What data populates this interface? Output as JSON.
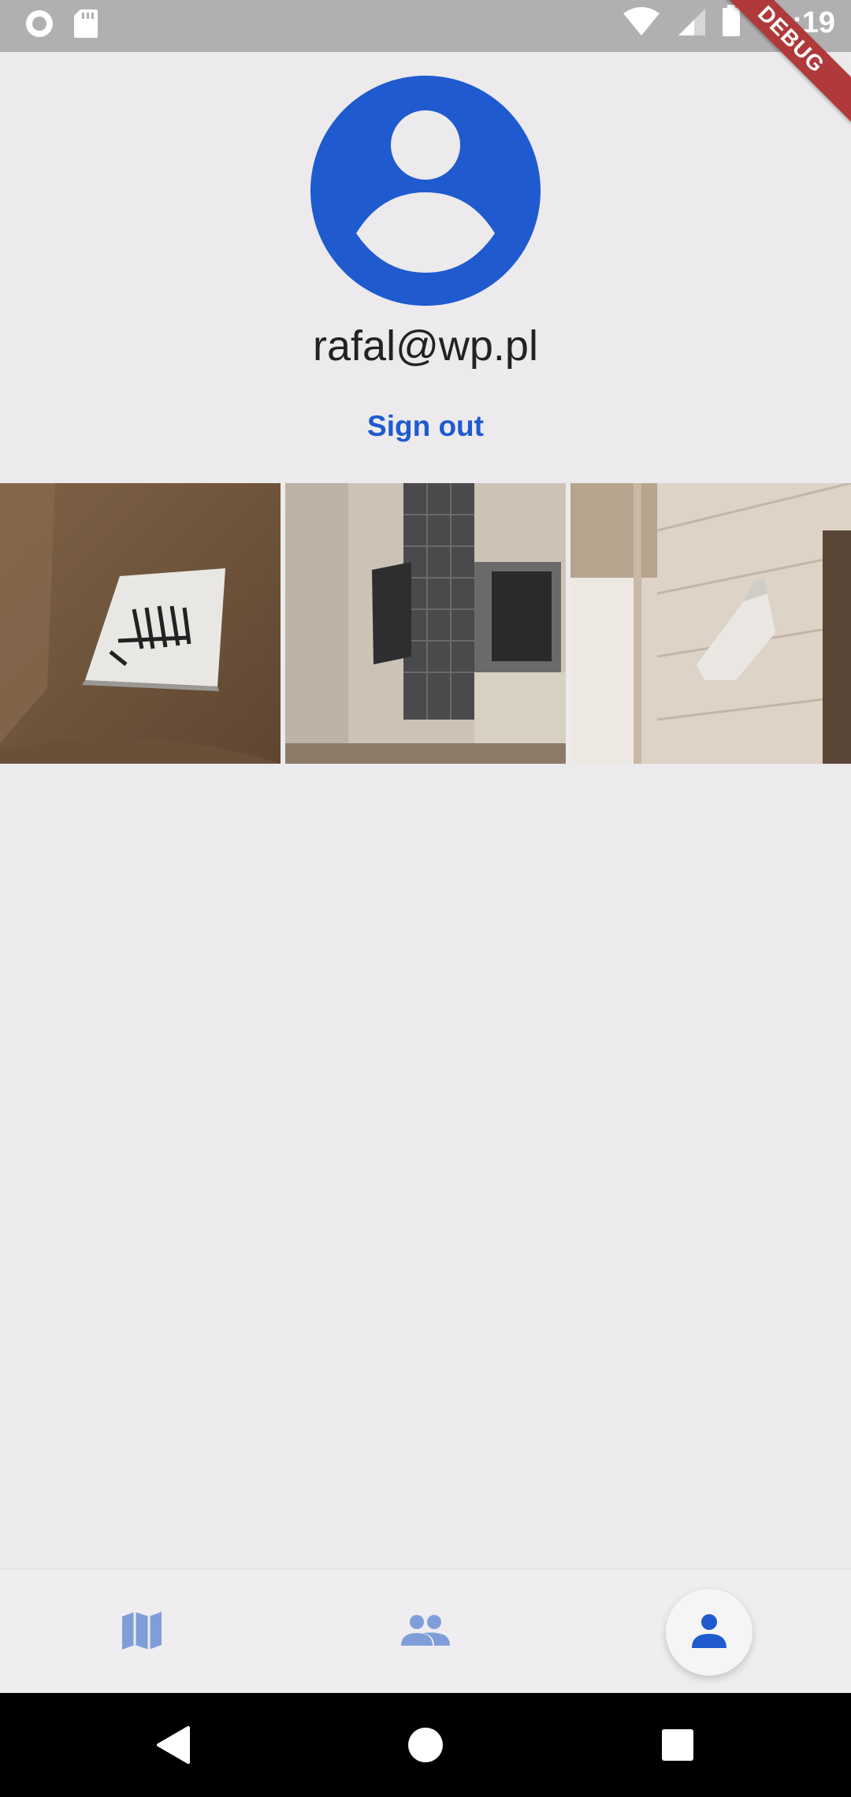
{
  "status_bar": {
    "time": "11:19",
    "icons": [
      "record-icon",
      "sd-card-icon",
      "wifi-icon",
      "signal-icon",
      "battery-icon"
    ],
    "debug_banner": "DEBUG"
  },
  "profile": {
    "email": "rafal@wp.pl",
    "sign_out_label": "Sign out",
    "avatar_icon": "account-circle-icon",
    "accent": "#1F5ACF"
  },
  "gallery": {
    "photos": [
      {
        "icon": "zebra-picture-photo"
      },
      {
        "icon": "bathroom-photo"
      },
      {
        "icon": "wall-sculpture-photo"
      }
    ]
  },
  "bottom_nav": {
    "items": [
      {
        "icon": "map-icon",
        "active": false
      },
      {
        "icon": "people-icon",
        "active": false
      },
      {
        "icon": "person-icon",
        "active": true
      }
    ]
  },
  "system_nav": {
    "icons": [
      "back-icon",
      "home-icon",
      "recents-icon"
    ]
  }
}
